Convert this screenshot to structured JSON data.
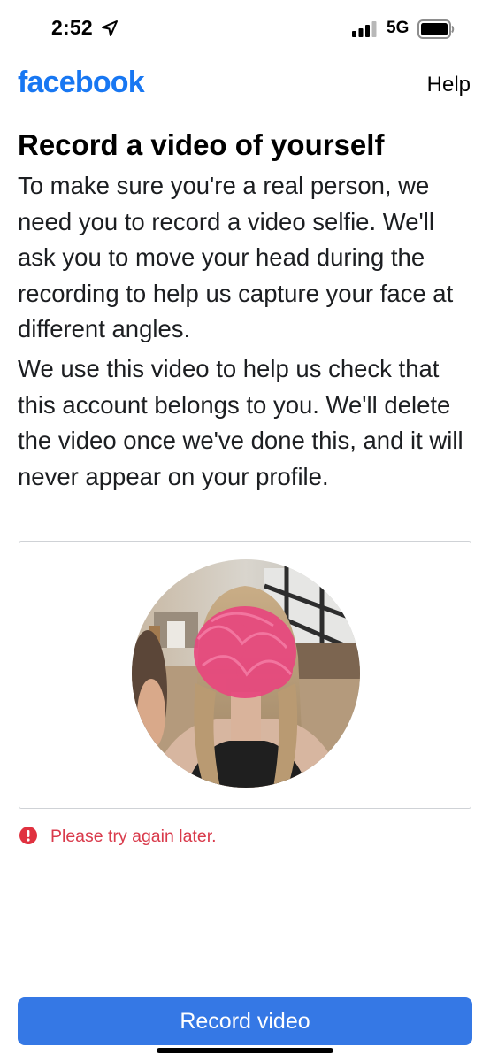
{
  "status_bar": {
    "time": "2:52",
    "network": "5G",
    "icons": [
      "location-arrow-icon",
      "cellular-signal-icon",
      "battery-icon"
    ]
  },
  "header": {
    "brand": "facebook",
    "help_label": "Help"
  },
  "main": {
    "title": "Record a video of yourself",
    "paragraphs": [
      "To make sure you're a real person, we need you to record a video selfie. We'll ask you to move your head during the recording to help us capture your face at different angles.",
      "We use this video to help us check that this account belongs to you. We'll delete the video once we've done this, and it will never appear on your profile."
    ]
  },
  "camera": {
    "preview_state": "live camera preview, face obscured"
  },
  "error": {
    "icon": "error-exclamation-icon",
    "message": "Please try again later."
  },
  "actions": {
    "record_label": "Record video"
  },
  "colors": {
    "brand_blue": "#1877f2",
    "button_blue": "#3578e5",
    "error_red": "#d93a4b"
  }
}
